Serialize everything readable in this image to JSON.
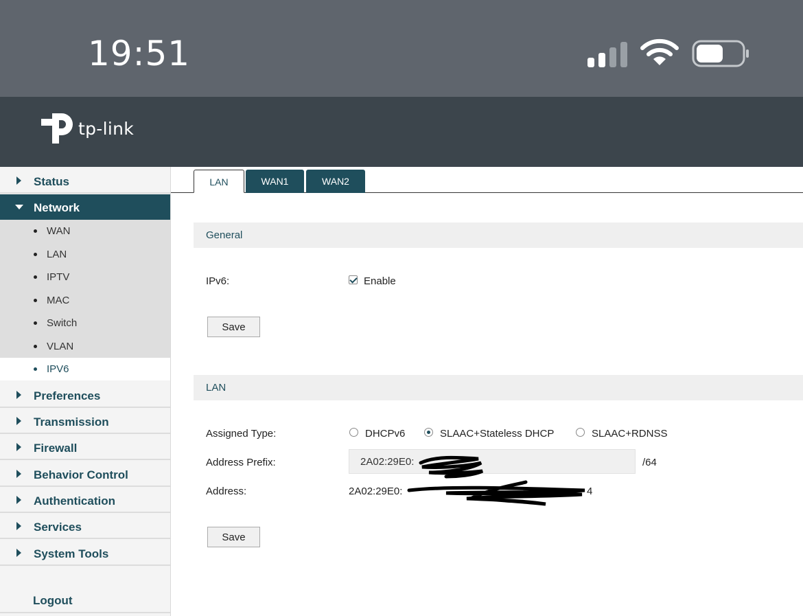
{
  "status_bar": {
    "time": "19:51",
    "icons": [
      "cellular-signal-icon",
      "wifi-icon",
      "battery-icon"
    ]
  },
  "header": {
    "brand": "tp-link",
    "logo_icon": "tp-link-logo-icon",
    "colors": {
      "header_bg": "#3c454c",
      "accent": "#1f4e5c"
    }
  },
  "sidebar": {
    "items": [
      {
        "label": "Status"
      },
      {
        "label": "Network"
      },
      {
        "label": "Preferences"
      },
      {
        "label": "Transmission"
      },
      {
        "label": "Firewall"
      },
      {
        "label": "Behavior Control"
      },
      {
        "label": "Authentication"
      },
      {
        "label": "Services"
      },
      {
        "label": "System Tools"
      }
    ],
    "network_sub": [
      {
        "label": "WAN"
      },
      {
        "label": "LAN"
      },
      {
        "label": "IPTV"
      },
      {
        "label": "MAC"
      },
      {
        "label": "Switch"
      },
      {
        "label": "VLAN"
      },
      {
        "label": "IPV6"
      }
    ],
    "selected_sub": "IPV6",
    "logout": "Logout"
  },
  "tabs": [
    {
      "label": "LAN"
    },
    {
      "label": "WAN1"
    },
    {
      "label": "WAN2"
    }
  ],
  "general": {
    "title": "General",
    "ipv6_label": "IPv6:",
    "enable_label": "Enable",
    "enable_checked": true,
    "save_label": "Save"
  },
  "lan": {
    "title": "LAN",
    "assigned_type_label": "Assigned Type:",
    "options": [
      {
        "label": "DHCPv6",
        "selected": false
      },
      {
        "label": "SLAAC+Stateless DHCP",
        "selected": true
      },
      {
        "label": "SLAAC+RDNSS",
        "selected": false
      }
    ],
    "address_prefix_label": "Address Prefix:",
    "address_prefix_value": "2A02:29E0:",
    "prefix_length": "/64",
    "address_label": "Address:",
    "address_value": "2A02:29E0:",
    "address_tail": "4",
    "save_label": "Save"
  }
}
